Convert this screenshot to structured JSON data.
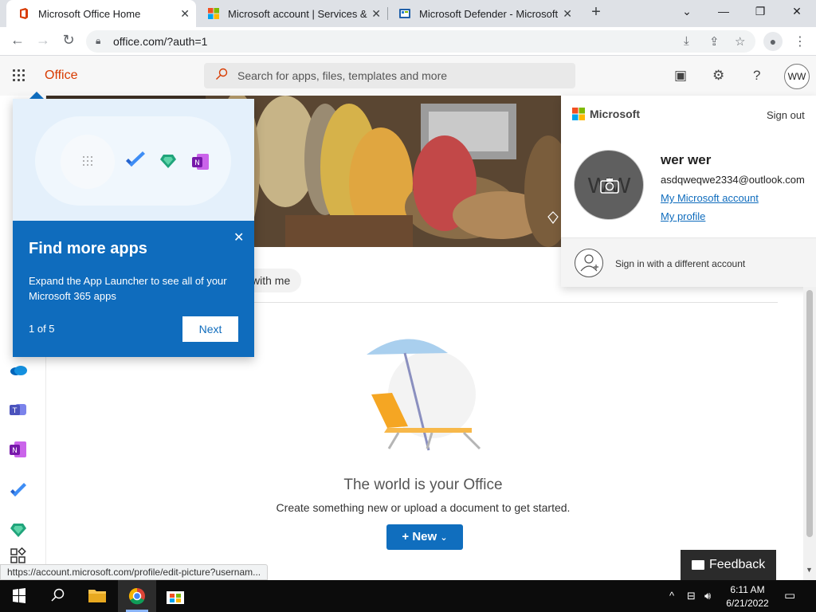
{
  "browser": {
    "tabs": [
      {
        "title": "Microsoft Office Home",
        "active": true,
        "favicon": "office-icon"
      },
      {
        "title": "Microsoft account | Services & su",
        "active": false,
        "favicon": "microsoft-logo-icon"
      },
      {
        "title": "Microsoft Defender - Microsoft S",
        "active": false,
        "favicon": "defender-icon"
      }
    ],
    "url": "office.com/?auth=1",
    "status_url": "https://account.microsoft.com/profile/edit-picture?usernam..."
  },
  "office": {
    "brand": "Office",
    "search_placeholder": "Search for apps, files, templates and more",
    "avatar_initials": "WW",
    "filter_pill": "with me",
    "empty_title": "The world is your Office",
    "empty_subtitle": "Create something new or upload a document to get started.",
    "new_button": "New",
    "feedback": "Feedback"
  },
  "callout": {
    "title": "Find more apps",
    "description": "Expand the App Launcher to see all of your Microsoft 365 apps",
    "count": "1 of 5",
    "next": "Next"
  },
  "account_panel": {
    "brand": "Microsoft",
    "sign_out": "Sign out",
    "photo_initials": "WW",
    "name": "wer wer",
    "email": "asdqweqwe2334@outlook.com",
    "link_account": "My Microsoft account",
    "link_profile": "My profile",
    "other_account": "Sign in with a different account"
  },
  "taskbar": {
    "time": "6:11 AM",
    "date": "6/21/2022"
  },
  "colors": {
    "office_accent": "#d83b01",
    "primary_blue": "#106ebe",
    "callout_blue": "#0f6cbd"
  }
}
